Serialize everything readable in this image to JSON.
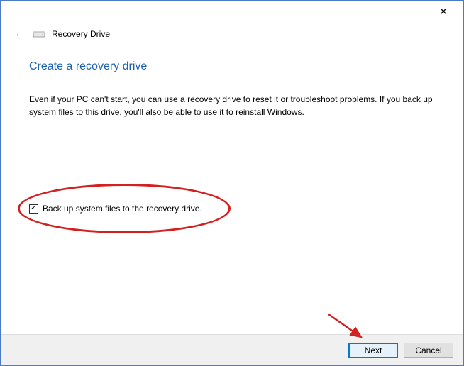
{
  "header": {
    "window_title": "Recovery Drive"
  },
  "main": {
    "page_title": "Create a recovery drive",
    "description": "Even if your PC can't start, you can use a recovery drive to reset it or troubleshoot problems. If you back up system files to this drive, you'll also be able to use it to reinstall Windows.",
    "checkbox_label": "Back up system files to the recovery drive.",
    "checkbox_checked": true
  },
  "buttons": {
    "next": "Next",
    "cancel": "Cancel"
  },
  "icons": {
    "close": "✕",
    "back": "←",
    "check": "✓"
  }
}
